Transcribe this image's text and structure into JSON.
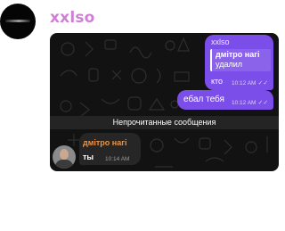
{
  "channel": {
    "name": "xxlso"
  },
  "chat": {
    "messages": [
      {
        "sender": "xxlso",
        "reply_author": "дмітро нагі",
        "reply_text": "удалил",
        "text": "кто",
        "time": "10:12 AM",
        "ticks": "✓✓"
      },
      {
        "text": "ебал тебя",
        "time": "10:12 AM",
        "ticks": "✓✓"
      }
    ],
    "unread_label": "Непрочитанные сообщения",
    "incoming": {
      "sender": "дмітро нагі",
      "text": "ты",
      "time": "10:14 AM"
    }
  },
  "colors": {
    "channel_name": "#cf7fd6",
    "outgoing_bubble": "#7c4ee9",
    "incoming_sender": "#e7934a",
    "chat_background": "#121212"
  }
}
